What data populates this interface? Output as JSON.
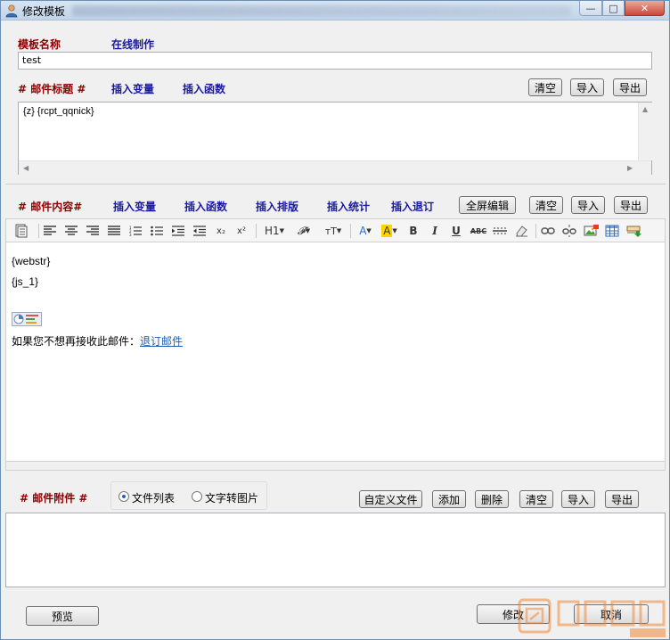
{
  "window": {
    "title": "修改模板",
    "controls": {
      "min": "—",
      "max": "□",
      "close": "✕"
    }
  },
  "template_name": {
    "label": "模板名称",
    "online_link": "在线制作",
    "value": "test"
  },
  "subject": {
    "label": "# 邮件标题 #",
    "insert_var": "插入变量",
    "insert_func": "插入函数",
    "clear": "清空",
    "import": "导入",
    "export": "导出",
    "value": "{z} {rcpt_qqnick}"
  },
  "content": {
    "label": "# 邮件内容#",
    "links": [
      "插入变量",
      "插入函数",
      "插入排版",
      "插入统计",
      "插入退订"
    ],
    "fullscreen": "全屏编辑",
    "clear": "清空",
    "import": "导入",
    "export": "导出",
    "toolbar": {
      "h1": "H1",
      "font": "𝓕",
      "size": "тT"
    },
    "lines": [
      "{webstr}",
      "{js_1}"
    ],
    "unsubscribe_text": "如果您不想再接收此邮件：",
    "unsubscribe_link": "退订邮件"
  },
  "attachment": {
    "label": "# 邮件附件 #",
    "options": [
      "文件列表",
      "文字转图片"
    ],
    "selected": 0,
    "custom_file": "自定义文件",
    "add": "添加",
    "delete": "删除",
    "clear": "清空",
    "import": "导入",
    "export": "导出"
  },
  "footer": {
    "preview": "预览",
    "modify": "修改",
    "cancel": "取消"
  },
  "colors": {
    "label_red": "#8b0000",
    "link_blue": "#1a1aa0",
    "hyperlink": "#1a5fb4"
  }
}
